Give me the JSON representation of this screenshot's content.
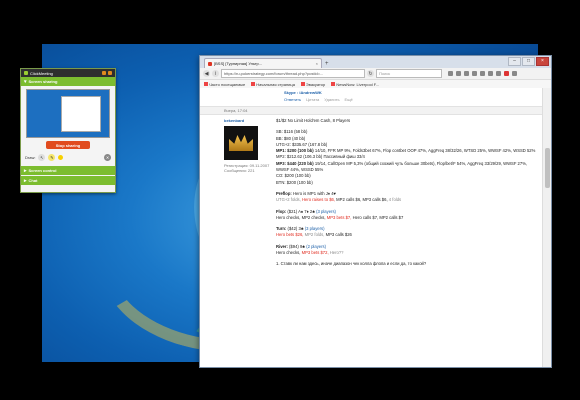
{
  "share_panel": {
    "title": "ClickMeeting",
    "section_sharing": "Screen sharing",
    "stop_label": "Stop sharing",
    "draw_label": "Draw:",
    "section_control": "Screen control",
    "section_chat": "Chat"
  },
  "browser": {
    "tab_title": "[BSS] [Турнирная] Ультр...",
    "url": "https://ru.pokerstrategy.com/forum/thread.php?postid=...",
    "search_placeholder": "Поиск",
    "bookmarks": [
      "Часто посещаемые",
      "Начальная страница",
      "Эвакуатор",
      "NewsNow: Liverpool F..."
    ]
  },
  "prev_post": {
    "skype": "Skype : iAndrewWK",
    "actions": [
      "Ответить",
      "Цитата",
      "Удалить",
      "Ещё"
    ]
  },
  "post": {
    "meta": "Вчера, 17:04",
    "author": "bekenbard",
    "author_meta": [
      "Регистрация: 09.11.2007",
      "Сообщения: 221"
    ],
    "title": "$1/$2 No Limit Hold'em Cash, 8 Players",
    "stacks": [
      "SB: $116 (58 bb)",
      "BB: $80 (40 bb)",
      "UTG+2: $335.67 (167.8 bb)"
    ],
    "mp1_label": "MP1: $200 (100 bb)",
    "mp1_text": " 14/10, FFR MP 9%, Folds3bet 67%, Flop contbet OOP 47%, AggFreq 38/32/26, WTSD 25%, WWSF 42%, WSSD 52%",
    "mp2": "MP2: $212.62 (106.3 bb) Пассивный фиш 33/4",
    "mp3_label": "MP3: $440 (220 bb)",
    "mp3_text": " 19/14, CallOpen MP 5,3% (общий схожий чуть больше 30bets), Flop/bet/F 54%, AggFreq 33/29/29, WWSF 27%, WWSF 44%, WSSD 55%",
    "co": "CO: $200 (100 bb)",
    "btn": "BTN: $200 (100 bb)",
    "preflop_label": "Preflop:",
    "preflop_text": " Hero is MP1 with  J♦ 4♥",
    "preflop_line2_a": "UTG+2 folds,",
    "preflop_line2_b": " Hero raises to $6,",
    "preflop_line2_c": " MP2 calls $6, MP3 calls $6,",
    "preflop_line2_d": " 4 folds",
    "flop_label": "Flop:",
    "flop_text": " ($21) A♠ 7♦ 2♣ ",
    "flop_players": "(3 players)",
    "flop_line_a": "Hero checks, MP2 checks,",
    "flop_line_b": " MP3 bets $7,",
    "flop_line_c": " Hero calls $7, MP2 calls $7",
    "turn_label": "Turn:",
    "turn_text": " ($42) 3♣ ",
    "turn_players": "(3 players)",
    "turn_line_a": "Hero bets $26,",
    "turn_line_b": " MP2 folds,",
    "turn_line_c": " MP3 calls $26",
    "river_label": "River:",
    "river_text": " ($94) 9♣ ",
    "river_players": "(2 players)",
    "river_line_a": "Hero checks,",
    "river_line_b": " MP3 bets $72,",
    "river_line_c": " Hero??",
    "question": "1. Ставк ли нам здесь, иначе диапазон чек колла флопа и если да, то какой?"
  }
}
